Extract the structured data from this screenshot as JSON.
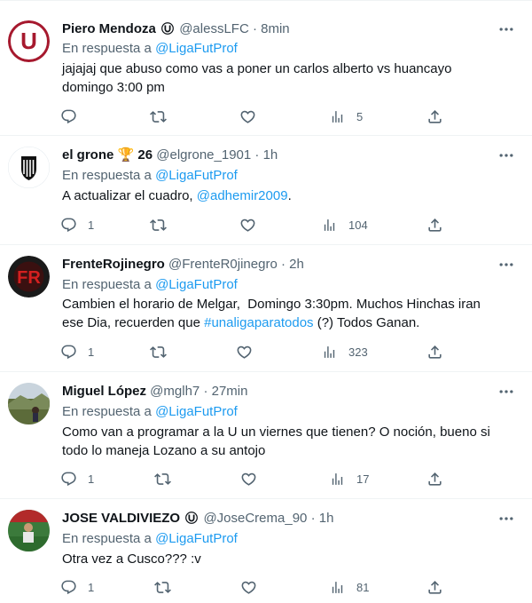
{
  "tweets": [
    {
      "name": "Piero Mendoza",
      "handle": "@alessLFC",
      "sep": "·",
      "time": "8min",
      "reply_label": "En respuesta a",
      "reply_to": "@LigaFutProf",
      "text_lines": [
        "jajajaj que abuso como vas a poner un carlos alberto vs huancayo",
        "domingo 3:00 pm"
      ],
      "replies": "",
      "views": "5"
    },
    {
      "name": "el grone",
      "trophy": "🏆",
      "number": "26",
      "handle": "@elgrone_1901",
      "sep": "·",
      "time": "1h",
      "reply_label": "En respuesta a",
      "reply_to": "@LigaFutProf",
      "text": "A actualizar el cuadro, ",
      "mention": "@adhemir2009",
      "text_end": ".",
      "replies": "1",
      "views": "104"
    },
    {
      "name": "FrenteRojinegro",
      "handle": "@FrenteR0jinegro",
      "sep": "·",
      "time": "2h",
      "reply_label": "En respuesta a",
      "reply_to": "@LigaFutProf",
      "line1": "Cambien el horario de Melgar,  Domingo 3:30pm. Muchos Hinchas iran",
      "line2_a": "ese Dia, recuerden que ",
      "hashtag": "#unaligaparatodos",
      "line2_b": " (?) Todos Ganan.",
      "replies": "1",
      "views": "323"
    },
    {
      "name": "Miguel López",
      "handle": "@mglh7",
      "sep": "·",
      "time": "27min",
      "reply_label": "En respuesta a",
      "reply_to": "@LigaFutProf",
      "text_lines": [
        "Como van a programar a la U un viernes que tienen? O noción, bueno si",
        "todo lo maneja Lozano a su antojo"
      ],
      "replies": "1",
      "views": "17"
    },
    {
      "name": "JOSE VALDIVIEZO",
      "handle": "@JoseCrema_90",
      "sep": "·",
      "time": "1h",
      "reply_label": "En respuesta a",
      "reply_to": "@LigaFutProf",
      "text_lines": [
        "Otra vez a Cusco??? :v"
      ],
      "replies": "1",
      "views": "81"
    }
  ],
  "avatar_letters": {
    "t1": "U",
    "t3": "FR"
  },
  "colors": {
    "link": "#1d9bf0",
    "secondary": "#536471",
    "text": "#0f1419",
    "divider": "#eff3f4",
    "u_red": "#a6192e"
  },
  "icons": [
    "reply-icon",
    "retweet-icon",
    "like-icon",
    "views-icon",
    "share-icon",
    "more-icon",
    "u-badge-icon",
    "trophy-icon"
  ]
}
